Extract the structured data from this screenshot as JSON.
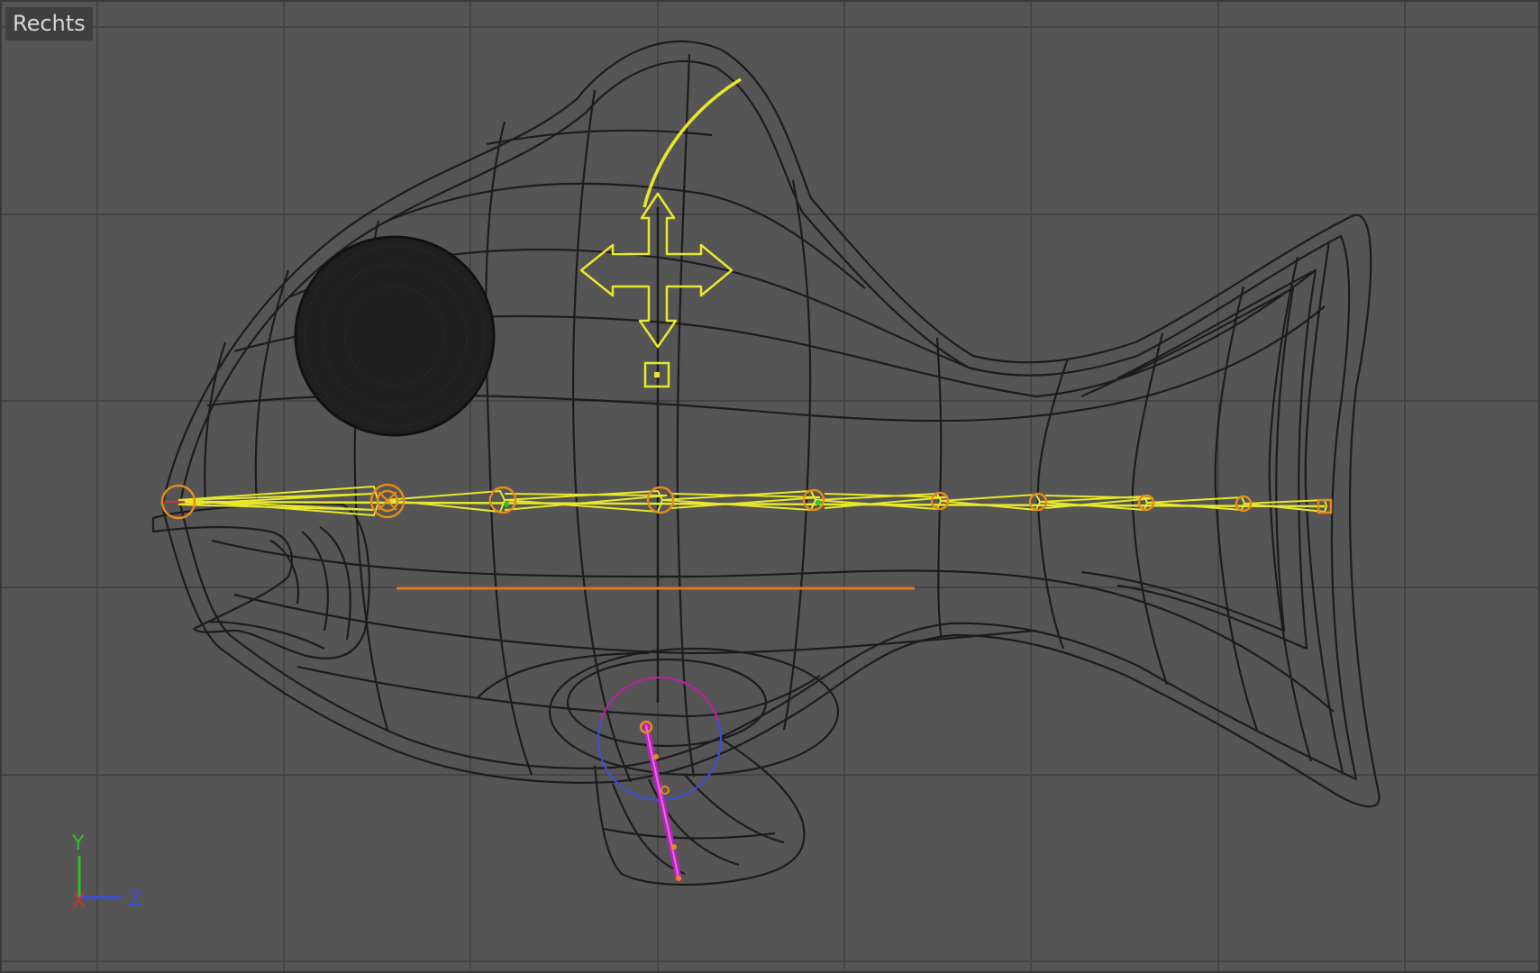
{
  "viewport": {
    "view_name": "Rechts",
    "background_color": "#555555",
    "grid_color": "#444444",
    "wireframe_color": "#1c1c1c",
    "selection_color": "#e8e82a",
    "joint_color": "#e88a1a"
  },
  "scene": {
    "model": "fish-wireframe",
    "bone_chain_joints": 11,
    "icons": [
      "move-manipulator-icon",
      "object-axis-icon"
    ]
  },
  "axis_gizmo": {
    "y_label": "Y",
    "z_label": "Z",
    "x_label": "X",
    "y_color": "#2fbf2f",
    "z_color": "#3a4fe0",
    "x_color": "#d23030"
  }
}
